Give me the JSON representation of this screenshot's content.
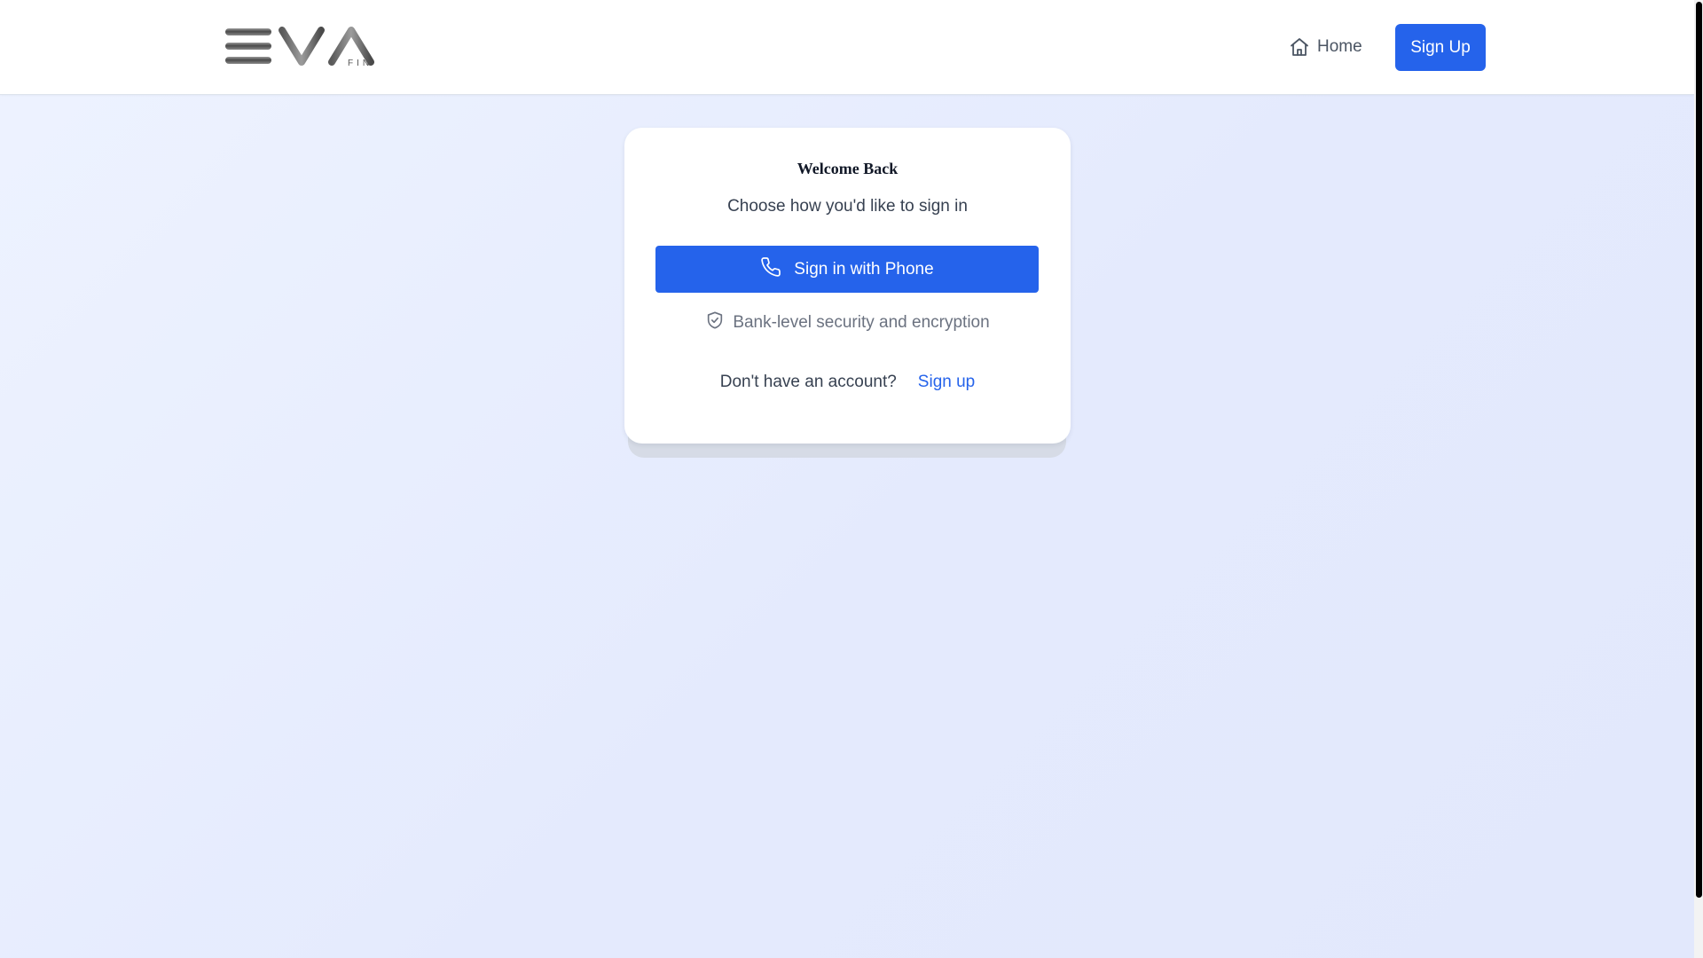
{
  "header": {
    "logo_alt": "EVA FIN",
    "logo_sub": "FIN",
    "home_label": "Home",
    "signup_label": "Sign Up"
  },
  "card": {
    "title": "Welcome Back",
    "subtitle": "Choose how you'd like to sign in",
    "phone_button_label": "Sign in with Phone",
    "security_text": "Bank-level security and encryption",
    "no_account_text": "Don't have an account?",
    "signup_link_label": "Sign up"
  },
  "icons": {
    "home": "home-icon",
    "phone": "phone-icon",
    "shield": "shield-check-icon"
  },
  "colors": {
    "accent": "#2563eb",
    "text_dark": "#111827",
    "text_body": "#374151",
    "text_muted": "#6b7280"
  }
}
